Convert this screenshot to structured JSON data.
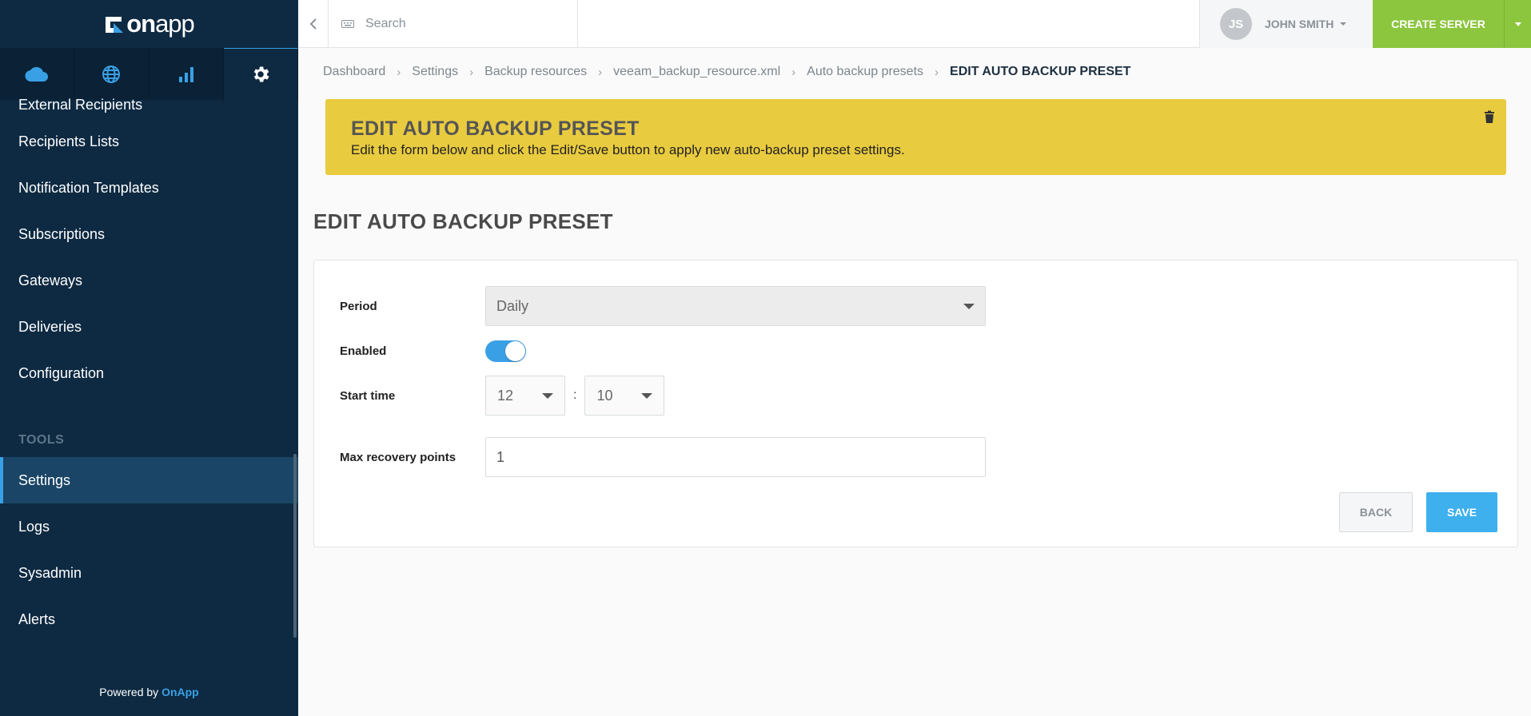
{
  "brand": {
    "logo_text_on": "on",
    "logo_text_app": "app",
    "accent": "#3aa0e6",
    "sidebar_bg": "#0e2a42",
    "create_green": "#8cc63f",
    "banner_yellow": "#e9cb3f"
  },
  "sidebar": {
    "tabs": [
      {
        "icon": "cloud-icon",
        "active": false
      },
      {
        "icon": "globe-icon",
        "active": false
      },
      {
        "icon": "bar-chart-icon",
        "active": false
      },
      {
        "icon": "gear-icon",
        "active": true
      }
    ],
    "items": [
      {
        "label": "External Recipients"
      },
      {
        "label": "Recipients Lists"
      },
      {
        "label": "Notification Templates"
      },
      {
        "label": "Subscriptions"
      },
      {
        "label": "Gateways"
      },
      {
        "label": "Deliveries"
      },
      {
        "label": "Configuration"
      }
    ],
    "section_label": "TOOLS",
    "tools_items": [
      {
        "label": "Settings",
        "active": true
      },
      {
        "label": "Logs"
      },
      {
        "label": "Sysadmin"
      },
      {
        "label": "Alerts"
      }
    ],
    "powered_prefix": "Powered by",
    "powered_brand": "OnApp"
  },
  "topbar": {
    "search_placeholder": "Search",
    "user_initials": "JS",
    "user_name": "JOHN SMITH",
    "create_label": "CREATE SERVER"
  },
  "breadcrumb": [
    {
      "label": "Dashboard"
    },
    {
      "label": "Settings"
    },
    {
      "label": "Backup resources"
    },
    {
      "label": "veeam_backup_resource.xml"
    },
    {
      "label": "Auto backup presets"
    },
    {
      "label": "EDIT AUTO BACKUP PRESET",
      "current": true
    }
  ],
  "banner": {
    "title": "EDIT AUTO BACKUP PRESET",
    "text": "Edit the form below and click the Edit/Save button to apply new auto-backup preset settings."
  },
  "page_title": "EDIT AUTO BACKUP PRESET",
  "form": {
    "period_label": "Period",
    "period_value": "Daily",
    "enabled_label": "Enabled",
    "enabled": true,
    "start_time_label": "Start time",
    "start_hour": "12",
    "time_separator": ":",
    "start_minute": "10",
    "max_points_label": "Max recovery points",
    "max_points_value": "1",
    "back_label": "BACK",
    "save_label": "SAVE"
  }
}
